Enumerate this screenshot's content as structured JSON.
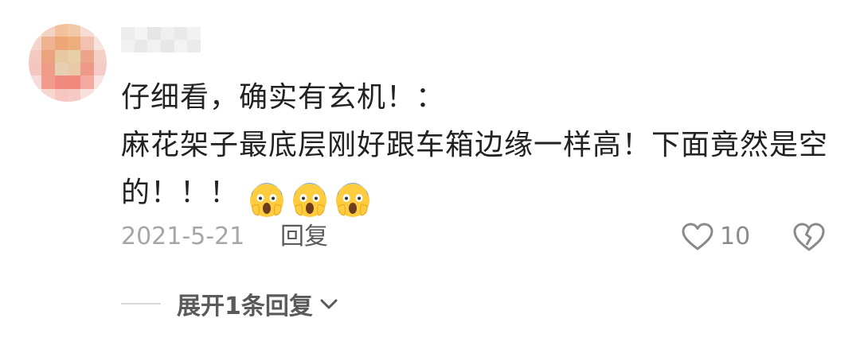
{
  "comment": {
    "lines": [
      "仔细看，确实有玄机！：",
      "麻花架子最底层刚好跟车箱边缘一样高！下面竟然是空",
      "的！！！"
    ],
    "emojis": [
      "face-screaming-in-fear-emoji",
      "face-screaming-in-fear-emoji",
      "face-screaming-in-fear-emoji"
    ],
    "date": "2021-5-21",
    "reply_label": "回复",
    "like_count": "10",
    "expand_label": "展开1条回复"
  },
  "icons": {
    "like": "heart-outline-icon",
    "dislike": "broken-heart-icon",
    "expand": "chevron-down-icon"
  },
  "colors": {
    "text": "#222222",
    "muted": "#a6a6a6",
    "secondary": "#5a5a5a"
  }
}
